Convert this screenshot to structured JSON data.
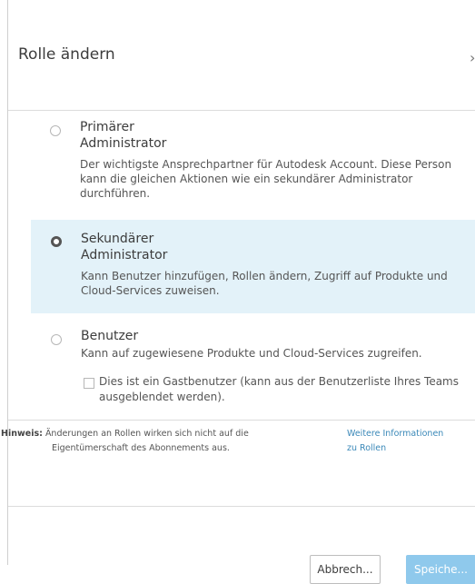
{
  "dialog": {
    "title": "Rolle ändern",
    "close_glyph": "›"
  },
  "roles": [
    {
      "title_line1": "Primärer",
      "title_line2": "Administrator",
      "description": "Der wichtigste Ansprechpartner für Autodesk Account. Diese Person kann die gleichen Aktionen wie ein sekundärer Administrator durchführen.",
      "selected": false
    },
    {
      "title_line1": "Sekundärer",
      "title_line2": "Administrator",
      "description": "Kann Benutzer hinzufügen, Rollen ändern, Zugriff auf Produkte und Cloud-Services zuweisen.",
      "selected": true
    },
    {
      "title_line1": "Benutzer",
      "description": "Kann auf zugewiesene Produkte und Cloud-Services zugreifen.",
      "selected": false
    }
  ],
  "guest_checkbox": {
    "label": "Dies ist ein Gastbenutzer (kann aus der Benutzerliste Ihres Teams ausgeblendet werden).",
    "checked": false
  },
  "note": {
    "prefix": "Hinweis:",
    "line1": "Änderungen an Rollen wirken sich nicht auf die",
    "line2": "Eigentümerschaft des Abonnements aus.",
    "link_line1": "Weitere Informationen",
    "link_line2": "zu Rollen"
  },
  "buttons": {
    "cancel": "Abbrech...",
    "save": "Speiche..."
  },
  "colors": {
    "selected_bg": "#e3f2f9",
    "link": "#3a88b8",
    "save_button": "#8fc9ec"
  }
}
